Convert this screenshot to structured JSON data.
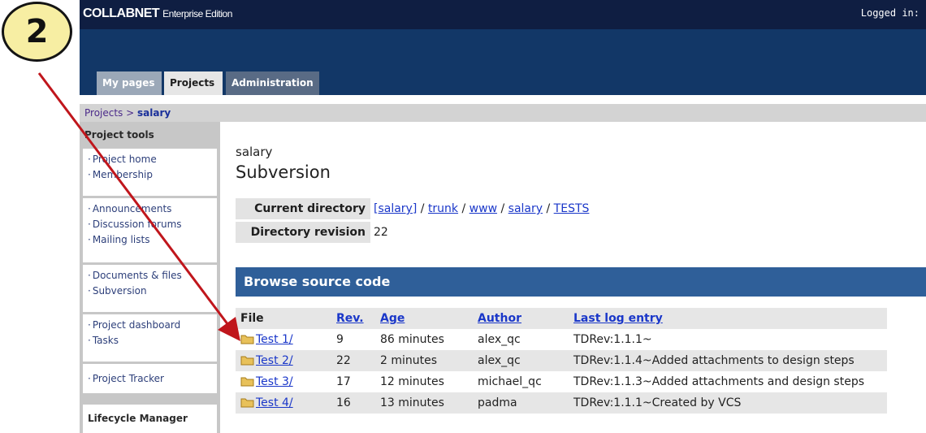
{
  "badge": {
    "number": "2"
  },
  "header": {
    "logo_brand": "COLLABNET",
    "logo_edition": "Enterprise Edition",
    "login_text": "Logged in:"
  },
  "tabs": [
    {
      "label": "My pages"
    },
    {
      "label": "Projects"
    },
    {
      "label": "Administration"
    }
  ],
  "breadcrumb": {
    "root": "Projects",
    "separator": ">",
    "current": "salary"
  },
  "sidebar": {
    "heading": "Project tools",
    "group1": [
      "Project home",
      "Membership"
    ],
    "group2": [
      "Announcements",
      "Discussion forums",
      "Mailing lists"
    ],
    "group3": [
      "Documents & files",
      "Subversion"
    ],
    "group4": [
      "Project dashboard",
      "Tasks"
    ],
    "group5": [
      "Project Tracker"
    ],
    "footer_heading": "Lifecycle Manager"
  },
  "main": {
    "project_name": "salary",
    "title": "Subversion",
    "current_dir_label": "Current directory",
    "path": [
      "[salary]",
      "trunk",
      "www",
      "salary",
      "TESTS"
    ],
    "path_sep": "/",
    "dir_rev_label": "Directory revision",
    "dir_rev_value": "22",
    "browse_title": "Browse source code",
    "columns": [
      "File",
      "Rev.",
      "Age",
      "Author",
      "Last log entry"
    ],
    "rows": [
      {
        "file": "Test 1/",
        "rev": "9",
        "age": "86 minutes",
        "author": "alex_qc",
        "log": "TDRev:1.1.1~"
      },
      {
        "file": "Test 2/",
        "rev": "22",
        "age": "2 minutes",
        "author": "alex_qc",
        "log": "TDRev:1.1.4~Added attachments to design steps"
      },
      {
        "file": "Test 3/",
        "rev": "17",
        "age": "12 minutes",
        "author": "michael_qc",
        "log": "TDRev:1.1.3~Added attachments and design steps"
      },
      {
        "file": "Test 4/",
        "rev": "16",
        "age": "13 minutes",
        "author": "padma",
        "log": "TDRev:1.1.1~Created by VCS"
      }
    ]
  },
  "colors": {
    "navy": "#123767",
    "accent": "#2f5f99",
    "arrow": "#c0161c",
    "badge": "#f7eea3"
  }
}
